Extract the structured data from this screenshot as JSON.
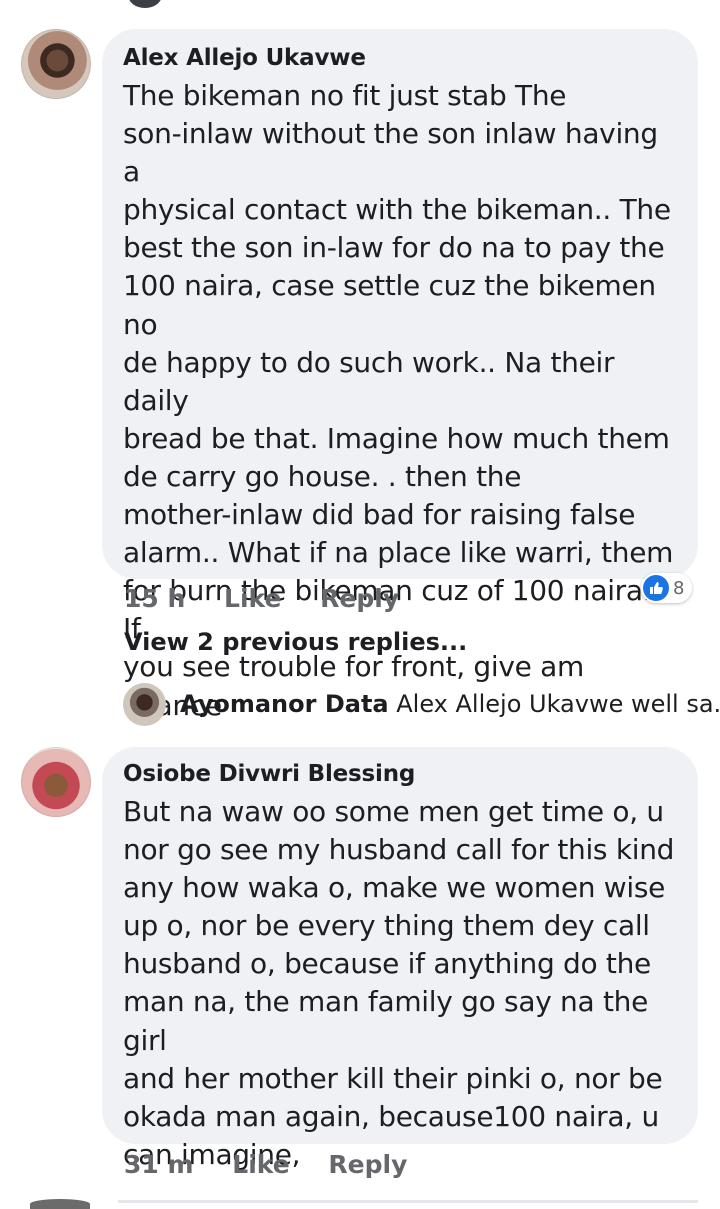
{
  "comments": [
    {
      "author": "Alex Allejo Ukavwe",
      "text": "The bikeman no fit just stab The\nson-inlaw without the son inlaw having a\nphysical contact with the bikeman..  The\nbest the son in-law for do na to pay the\n100 naira, case settle cuz the bikemen no\nde happy to do such work..  Na their daily\nbread be that.  Imagine how much them\nde carry go house. . then the\nmother-inlaw did bad for raising false\nalarm..  What if na place like warri,  them\nfor burn the bikeman cuz of 100 naira..  If\nyou see trouble for front,  give am\nchance",
      "time": "15 h",
      "like_label": "Like",
      "reply_label": "Reply",
      "reaction_count": "8",
      "view_previous": "View 2 previous replies...",
      "latest_reply": {
        "author": "Ayomanor Data",
        "preview": "Alex Allejo Ukavwe well sa..."
      }
    },
    {
      "author": "Osiobe Divwri Blessing",
      "text": "But na waw oo some men get time o, u\nnor go see my husband call for this kind\nany how waka o, make we women wise\nup o, nor be every thing them dey call\nhusband o, because if anything do the\nman na, the man family go say na the girl\nand her mother kill their pinki o, nor be\nokada man again, because100 naira, u\ncan imagine,",
      "time": "31 m",
      "like_label": "Like",
      "reply_label": "Reply"
    }
  ],
  "colors": {
    "bubble": "#f0f1f4",
    "meta_text": "#65676b",
    "like_blue": "#1b74e4"
  }
}
